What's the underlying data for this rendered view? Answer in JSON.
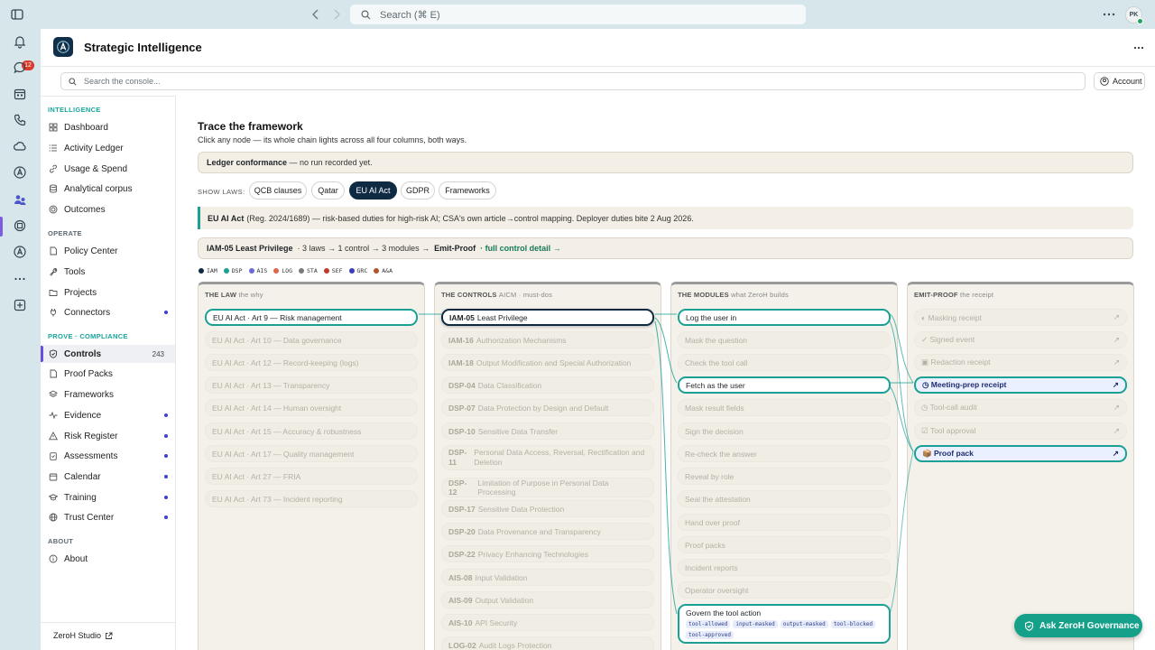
{
  "topbar": {
    "search_placeholder": "Search (⌘ E)",
    "avatar_initials": "PK"
  },
  "rail": {
    "notifications_badge": "12"
  },
  "header": {
    "title": "Strategic Intelligence"
  },
  "console": {
    "placeholder": "Search the console...",
    "account_label": "Account"
  },
  "sidebar": {
    "sections": {
      "intelligence": "INTELLIGENCE",
      "operate": "OPERATE",
      "prove": "PROVE · COMPLIANCE",
      "about": "ABOUT"
    },
    "intelligence": [
      "Dashboard",
      "Activity Ledger",
      "Usage & Spend",
      "Analytical corpus",
      "Outcomes"
    ],
    "operate": [
      "Policy Center",
      "Tools",
      "Projects",
      "Connectors"
    ],
    "prove": [
      "Controls",
      "Proof Packs",
      "Frameworks",
      "Evidence",
      "Risk Register",
      "Assessments",
      "Calendar",
      "Training",
      "Trust Center"
    ],
    "about": [
      "About"
    ],
    "controls_count": "243",
    "footer": "ZeroH Studio"
  },
  "content": {
    "title": "Trace the framework",
    "subtitle": "Click any node — its whole chain lights across all four columns, both ways.",
    "ledger_bold": "Ledger conformance",
    "ledger_rest": "— no run recorded yet.",
    "show_laws_label": "SHOW LAWS:",
    "laws": [
      "QCB clauses",
      "Qatar",
      "EU AI Act",
      "GDPR",
      "Frameworks"
    ],
    "selected_law": "EU AI Act",
    "eu_bold": "EU AI Act",
    "eu_rest": "(Reg. 2024/1689) — risk-based duties for high-risk AI; CSA's own article→control mapping. Deployer duties bite 2 Aug 2026.",
    "chain_bold": "IAM-05 Least Privilege",
    "chain_middle": "· 3 laws → 1 control → 3 modules →",
    "chain_end": "Emit-Proof",
    "chain_link": "· full control detail →",
    "legend": [
      {
        "code": "IAM",
        "color": "#0f2b44"
      },
      {
        "code": "DSP",
        "color": "#1aa095"
      },
      {
        "code": "AIS",
        "color": "#6b6bd6"
      },
      {
        "code": "LOG",
        "color": "#e0664a"
      },
      {
        "code": "STA",
        "color": "#7a7a7a"
      },
      {
        "code": "SEF",
        "color": "#c0392b"
      },
      {
        "code": "GRC",
        "color": "#3a3fb8"
      },
      {
        "code": "A&A",
        "color": "#b5542a"
      }
    ]
  },
  "columns": {
    "law": {
      "title": "THE LAW",
      "sub": "the why",
      "items": [
        "EU AI Act · Art 9 — Risk management",
        "EU AI Act · Art 10 — Data governance",
        "EU AI Act · Art 12 — Record-keeping (logs)",
        "EU AI Act · Art 13 — Transparency",
        "EU AI Act · Art 14 — Human oversight",
        "EU AI Act · Art 15 — Accuracy & robustness",
        "EU AI Act · Art 17 — Quality management",
        "EU AI Act · Art 27 — FRIA",
        "EU AI Act · Art 73 — Incident reporting"
      ]
    },
    "controls": {
      "title": "THE CONTROLS",
      "sub": "AICM · must-dos",
      "items": [
        {
          "code": "IAM-05",
          "name": "Least Privilege"
        },
        {
          "code": "IAM-16",
          "name": "Authorization Mechanisms"
        },
        {
          "code": "IAM-18",
          "name": "Output Modification and Special Authorization"
        },
        {
          "code": "DSP-04",
          "name": "Data Classification"
        },
        {
          "code": "DSP-07",
          "name": "Data Protection by Design and Default"
        },
        {
          "code": "DSP-10",
          "name": "Sensitive Data Transfer"
        },
        {
          "code": "DSP-11",
          "name": "Personal Data Access, Reversal, Rectification and Deletion"
        },
        {
          "code": "DSP-12",
          "name": "Limitation of Purpose in Personal Data Processing"
        },
        {
          "code": "DSP-17",
          "name": "Sensitive Data Protection"
        },
        {
          "code": "DSP-20",
          "name": "Data Provenance and Transparency"
        },
        {
          "code": "DSP-22",
          "name": "Privacy Enhancing Technologies"
        },
        {
          "code": "AIS-08",
          "name": "Input Validation"
        },
        {
          "code": "AIS-09",
          "name": "Output Validation"
        },
        {
          "code": "AIS-10",
          "name": "API Security"
        },
        {
          "code": "LOG-02",
          "name": "Audit Logs Protection"
        }
      ]
    },
    "modules": {
      "title": "THE MODULES",
      "sub": "what ZeroH builds",
      "items": [
        "Log the user in",
        "Mask the question",
        "Check the tool call",
        "Fetch as the user",
        "Mask result fields",
        "Sign the decision",
        "Re-check the answer",
        "Reveal by role",
        "Seal the attestation",
        "Hand over proof",
        "Proof packs",
        "Incident reports",
        "Operator oversight"
      ],
      "govern": {
        "label": "Govern the tool action",
        "tags": [
          "tool-allowed",
          "input-masked",
          "output-masked",
          "tool-blocked",
          "tool-approved"
        ]
      }
    },
    "proof": {
      "title": "EMIT-PROOF",
      "sub": "the receipt",
      "items": [
        {
          "icon": "◐",
          "label": "Masking receipt"
        },
        {
          "icon": "✓",
          "label": "Signed event"
        },
        {
          "icon": "▣",
          "label": "Redaction receipt"
        },
        {
          "icon": "◷",
          "label": "Meeting-prep receipt"
        },
        {
          "icon": "◷",
          "label": "Tool-call audit"
        },
        {
          "icon": "☑",
          "label": "Tool approval"
        },
        {
          "icon": "📦",
          "label": "Proof pack"
        }
      ],
      "arrow": "↗"
    }
  },
  "ask_button": "Ask ZeroH Governance"
}
